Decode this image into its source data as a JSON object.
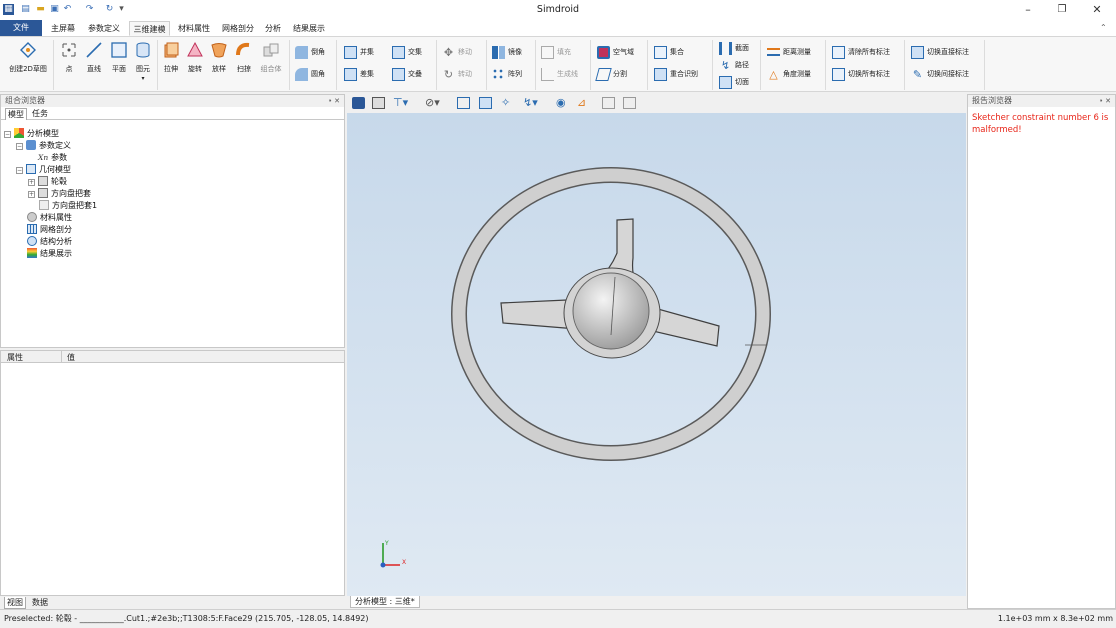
{
  "window": {
    "title": "Simdroid",
    "minimize": "–",
    "restore": "❐",
    "close": "✕"
  },
  "colors": {
    "file_tab": "#2b5797",
    "viewport_top": "#c6d8ea",
    "viewport_bottom": "#dfe9f3",
    "error_text": "#e8261a"
  },
  "tabs": [
    "文件",
    "主屏幕",
    "参数定义",
    "三维建模",
    "材料属性",
    "网格剖分",
    "分析",
    "结果展示"
  ],
  "ribbon": {
    "large": [
      "创建2D草图",
      "点",
      "直线",
      "平面",
      "图元",
      "拉伸",
      "旋转",
      "放样",
      "扫掠",
      "组合体"
    ],
    "small": [
      "倒角",
      "圆角",
      "并集",
      "差集",
      "交集",
      "交叠",
      "移动",
      "转动",
      "镜像",
      "阵列",
      "填充",
      "生成线",
      "空气域",
      "分割",
      "集合",
      "重合识别",
      "截面",
      "路径",
      "切面",
      "距离测量",
      "角度测量",
      "清除所有标注",
      "切换所有标注",
      "切换直接标注",
      "切换间接标注"
    ]
  },
  "left_panel": {
    "title": "组合浏览器",
    "tabs": [
      "模型",
      "任务"
    ],
    "tree": [
      "分析模型",
      "参数定义",
      "参数",
      "几何模型",
      "轮毂",
      "方向盘把套",
      "方向盘把套1",
      "材料属性",
      "网格剖分",
      "结构分析",
      "结果展示"
    ],
    "param_prefix": "Xn"
  },
  "props_panel": {
    "col1": "属性",
    "col2": "值",
    "tabs": [
      "视图",
      "数据"
    ]
  },
  "viewport": {
    "tab": "分析模型 : 三维*"
  },
  "report": {
    "title": "报告浏览器",
    "message": "Sketcher constraint number 6 is malformed!"
  },
  "status": {
    "left": "Preselected: 轮毂 - ___________.Cut1.;#2e3b;;T1308:5:F.Face29 (215.705, -128.05, 14.8492)",
    "right": "1.1e+03 mm x 8.3e+02 mm"
  }
}
